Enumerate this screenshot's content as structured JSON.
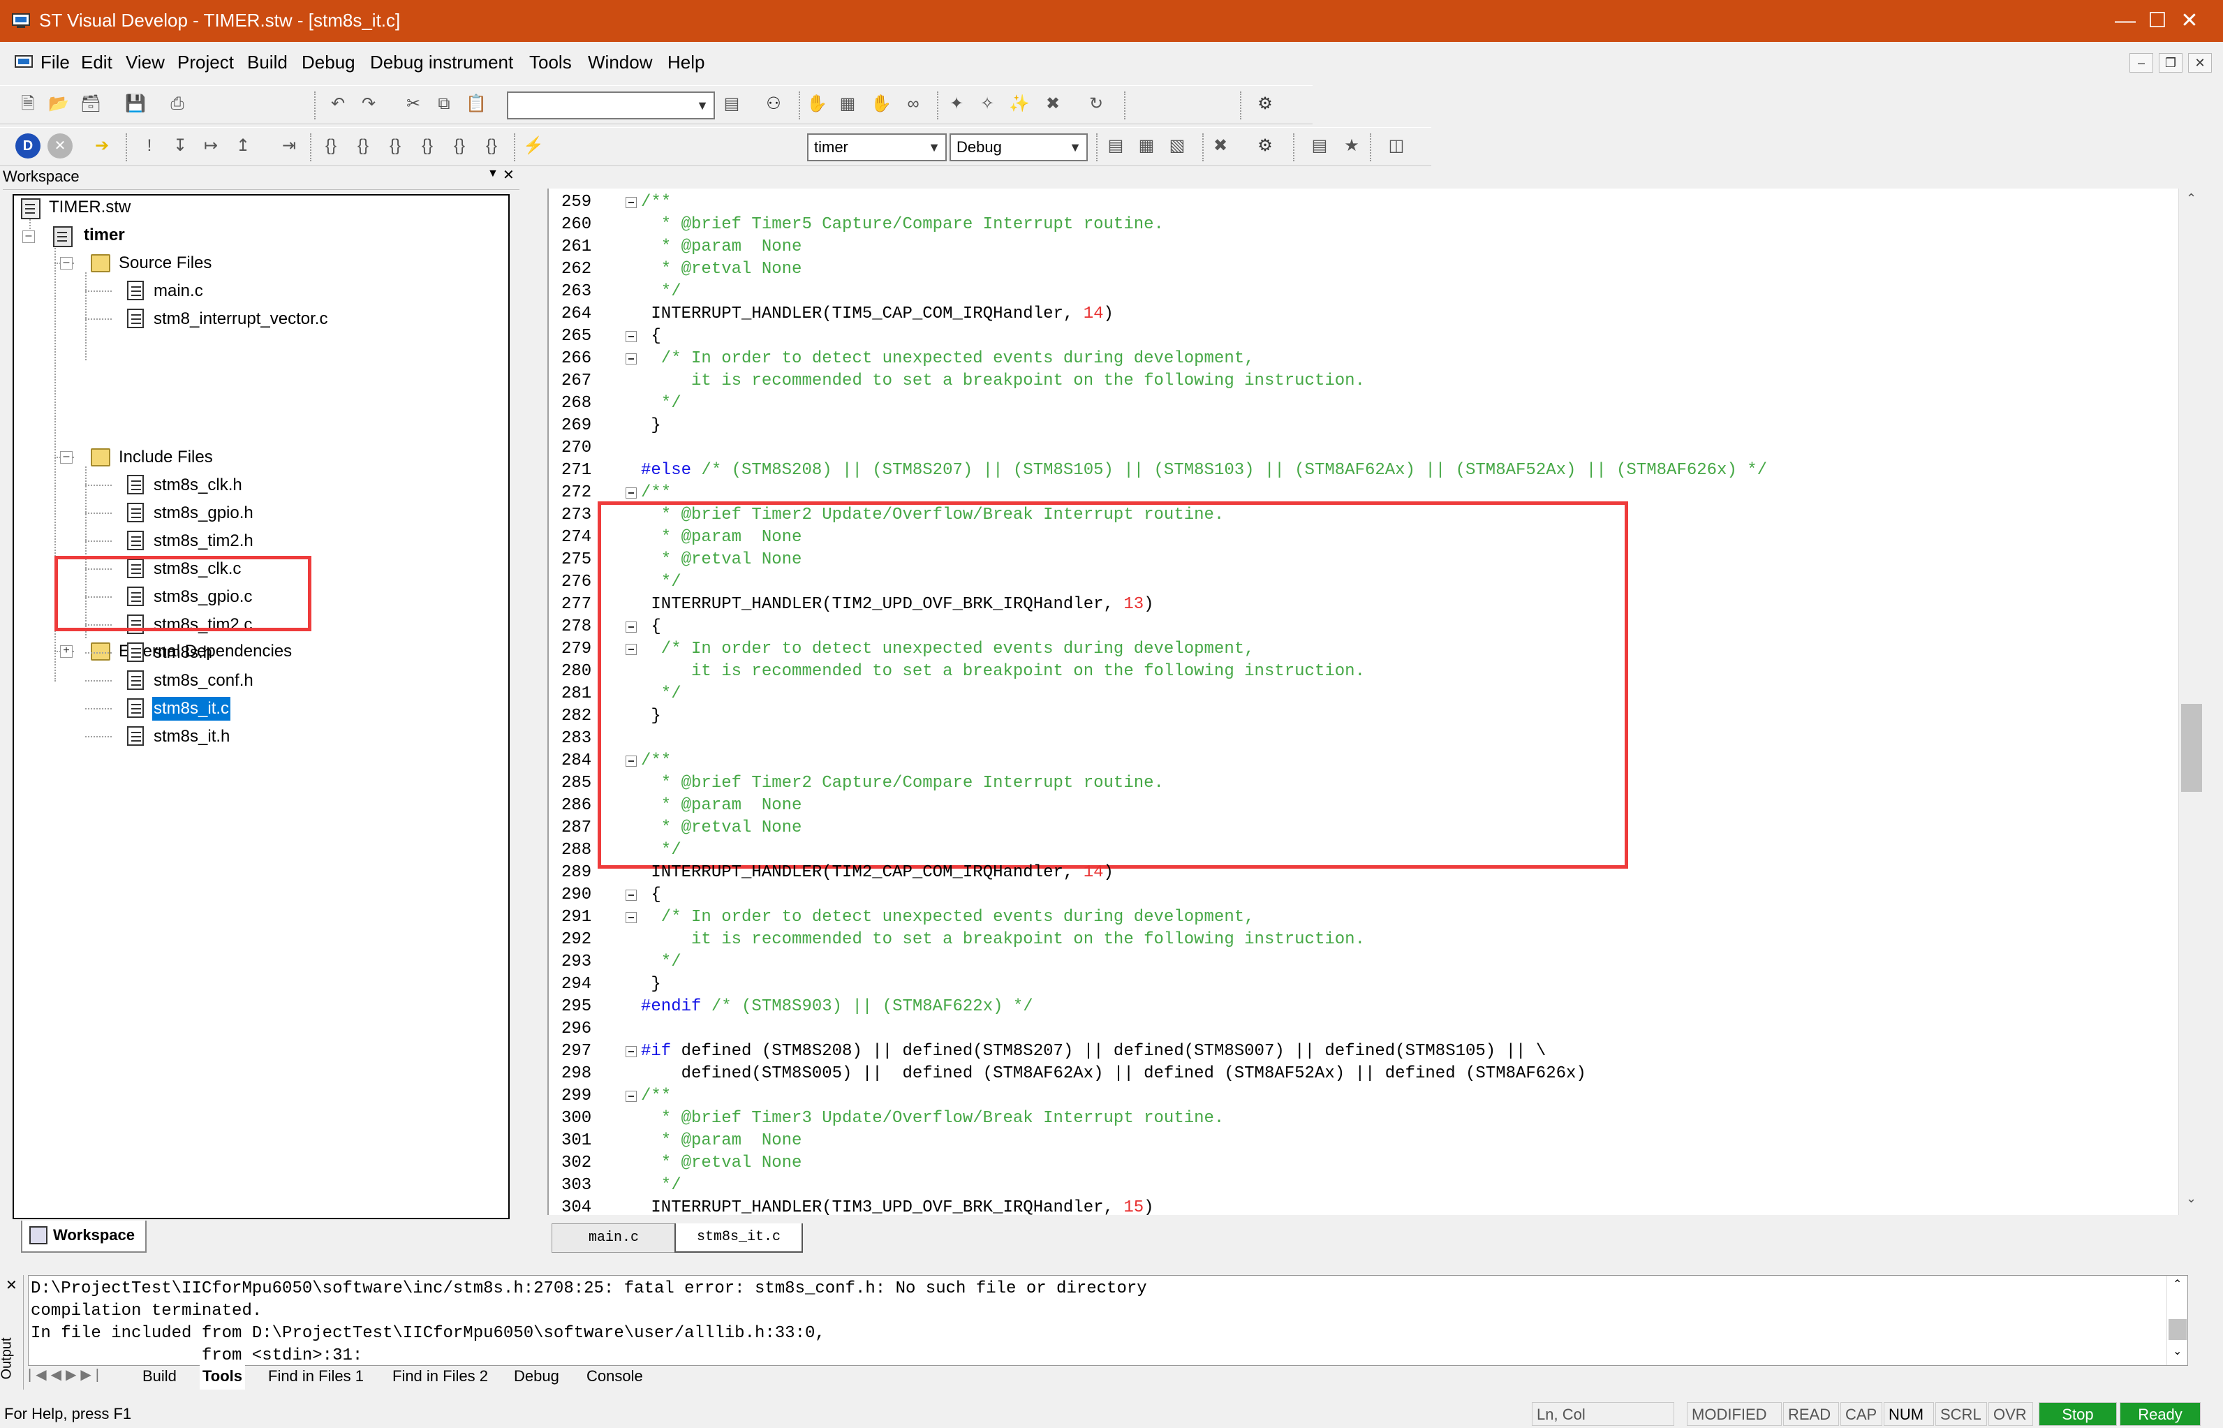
{
  "window": {
    "title": "ST Visual Develop - TIMER.stw - [stm8s_it.c]"
  },
  "menu": [
    "File",
    "Edit",
    "View",
    "Project",
    "Build",
    "Debug",
    "Debug instrument",
    "Tools",
    "Window",
    "Help"
  ],
  "toolbar": {
    "search_combo": "",
    "project_combo": "timer",
    "config_combo": "Debug"
  },
  "workspace": {
    "header": "Workspace",
    "tab": "Workspace",
    "tree": {
      "root": "TIMER.stw",
      "project": "timer",
      "source_folder": "Source Files",
      "source_files": [
        "main.c",
        "stm8_interrupt_vector.c"
      ],
      "include_folder": "Include Files",
      "include_files": [
        "stm8s_clk.h",
        "stm8s_gpio.h",
        "stm8s_tim2.h",
        "stm8s_clk.c",
        "stm8s_gpio.c",
        "stm8s_tim2.c",
        "stm8s.h",
        "stm8s_conf.h",
        "stm8s_it.c",
        "stm8s_it.h"
      ],
      "external_folder": "External Dependencies"
    }
  },
  "editor": {
    "tabs": [
      "main.c",
      "stm8s_it.c"
    ],
    "lines": [
      {
        "n": "259",
        "t": "/**",
        "k": "com",
        "fold": true
      },
      {
        "n": "260",
        "t": "  * @brief Timer5 Capture/Compare Interrupt routine.",
        "k": "com"
      },
      {
        "n": "261",
        "t": "  * @param  None",
        "k": "com"
      },
      {
        "n": "262",
        "t": "  * @retval None",
        "k": "com"
      },
      {
        "n": "263",
        "t": "  */",
        "k": "com"
      },
      {
        "n": "264",
        "t": " INTERRUPT_HANDLER(TIM5_CAP_COM_IRQHandler, ",
        "num": "14",
        "after": ")"
      },
      {
        "n": "265",
        "t": " {",
        "fold": true
      },
      {
        "n": "266",
        "t": "  /* In order to detect unexpected events during development,",
        "k": "com",
        "fold": true
      },
      {
        "n": "267",
        "t": "     it is recommended to set a breakpoint on the following instruction.",
        "k": "com"
      },
      {
        "n": "268",
        "t": "  */",
        "k": "com"
      },
      {
        "n": "269",
        "t": " }"
      },
      {
        "n": "270",
        "t": ""
      },
      {
        "n": "271",
        "t": "#else",
        "k": "kw",
        "after_com": " /* (STM8S208) || (STM8S207) || (STM8S105) || (STM8S103) || (STM8AF62Ax) || (STM8AF52Ax) || (STM8AF626x) */"
      },
      {
        "n": "272",
        "t": "/**",
        "k": "com",
        "fold": true
      },
      {
        "n": "273",
        "t": "  * @brief Timer2 Update/Overflow/Break Interrupt routine.",
        "k": "com"
      },
      {
        "n": "274",
        "t": "  * @param  None",
        "k": "com"
      },
      {
        "n": "275",
        "t": "  * @retval None",
        "k": "com"
      },
      {
        "n": "276",
        "t": "  */",
        "k": "com"
      },
      {
        "n": "277",
        "t": " INTERRUPT_HANDLER(TIM2_UPD_OVF_BRK_IRQHandler, ",
        "num": "13",
        "after": ")"
      },
      {
        "n": "278",
        "t": " {",
        "fold": true
      },
      {
        "n": "279",
        "t": "  /* In order to detect unexpected events during development,",
        "k": "com",
        "fold": true
      },
      {
        "n": "280",
        "t": "     it is recommended to set a breakpoint on the following instruction.",
        "k": "com"
      },
      {
        "n": "281",
        "t": "  */",
        "k": "com"
      },
      {
        "n": "282",
        "t": " }"
      },
      {
        "n": "283",
        "t": ""
      },
      {
        "n": "284",
        "t": "/**",
        "k": "com",
        "fold": true
      },
      {
        "n": "285",
        "t": "  * @brief Timer2 Capture/Compare Interrupt routine.",
        "k": "com"
      },
      {
        "n": "286",
        "t": "  * @param  None",
        "k": "com"
      },
      {
        "n": "287",
        "t": "  * @retval None",
        "k": "com"
      },
      {
        "n": "288",
        "t": "  */",
        "k": "com"
      },
      {
        "n": "289",
        "t": " INTERRUPT_HANDLER(TIM2_CAP_COM_IRQHandler, ",
        "num": "14",
        "after": ")"
      },
      {
        "n": "290",
        "t": " {",
        "fold": true
      },
      {
        "n": "291",
        "t": "  /* In order to detect unexpected events during development,",
        "k": "com",
        "fold": true
      },
      {
        "n": "292",
        "t": "     it is recommended to set a breakpoint on the following instruction.",
        "k": "com"
      },
      {
        "n": "293",
        "t": "  */",
        "k": "com"
      },
      {
        "n": "294",
        "t": " }"
      },
      {
        "n": "295",
        "t": "#endif",
        "k": "kw",
        "after_com": " /* (STM8S903) || (STM8AF622x) */"
      },
      {
        "n": "296",
        "t": ""
      },
      {
        "n": "297",
        "t": "#if",
        "k": "kw",
        "fold": true,
        "after_plain": " defined (STM8S208) || defined(STM8S207) || defined(STM8S007) || defined(STM8S105) || \\"
      },
      {
        "n": "298",
        "t": "    defined(STM8S005) ||  defined (STM8AF62Ax) || defined (STM8AF52Ax) || defined (STM8AF626x)"
      },
      {
        "n": "299",
        "t": "/**",
        "k": "com",
        "fold": true
      },
      {
        "n": "300",
        "t": "  * @brief Timer3 Update/Overflow/Break Interrupt routine.",
        "k": "com"
      },
      {
        "n": "301",
        "t": "  * @param  None",
        "k": "com"
      },
      {
        "n": "302",
        "t": "  * @retval None",
        "k": "com"
      },
      {
        "n": "303",
        "t": "  */",
        "k": "com"
      },
      {
        "n": "304",
        "t": " INTERRUPT_HANDLER(TIM3_UPD_OVF_BRK_IRQHandler, ",
        "num": "15",
        "after": ")"
      }
    ]
  },
  "output": {
    "side_label": "Output",
    "lines": [
      "D:\\ProjectTest\\IICforMpu6050\\software\\inc/stm8s.h:2708:25: fatal error: stm8s_conf.h: No such file or directory",
      "compilation terminated.",
      "In file included from D:\\ProjectTest\\IICforMpu6050\\software\\user/alllib.h:33:0,",
      "                 from <stdin>:31:"
    ],
    "tabs": [
      "Build",
      "Tools",
      "Find in Files 1",
      "Find in Files 2",
      "Debug",
      "Console"
    ]
  },
  "status": {
    "help": "For Help, press F1",
    "position": "Ln, Col",
    "modified": "MODIFIED",
    "read": "READ",
    "cap": "CAP",
    "num": "NUM",
    "scrl": "SCRL",
    "ovr": "OVR",
    "stop": "Stop",
    "ready": "Ready",
    "accent": "#1a9c2a"
  },
  "colors": {
    "titlebar": "#cc4c11",
    "highlight_box": "#ee3b3b",
    "selection": "#0078d7"
  }
}
